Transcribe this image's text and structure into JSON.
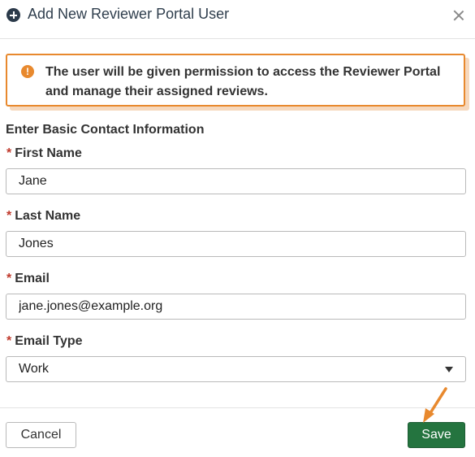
{
  "dialog": {
    "title": "Add New Reviewer Portal User",
    "header_icon": "plus-circle-icon",
    "close_icon": "close-icon"
  },
  "alert": {
    "icon": "exclamation-circle-icon",
    "icon_glyph": "!",
    "message": "The user will be given permission to access the Reviewer Portal and manage their assigned reviews.",
    "color": "#e8892e"
  },
  "form": {
    "section_title": "Enter Basic Contact Information",
    "required_marker": "*",
    "first_name": {
      "label": "First Name",
      "value": "Jane"
    },
    "last_name": {
      "label": "Last Name",
      "value": "Jones"
    },
    "email": {
      "label": "Email",
      "value": "jane.jones@example.org"
    },
    "email_type": {
      "label": "Email Type",
      "value": "Work"
    }
  },
  "footer": {
    "cancel_label": "Cancel",
    "save_label": "Save",
    "save_color": "#24743f"
  },
  "annotation": {
    "type": "arrow",
    "target": "save-button",
    "color": "#e8892e"
  }
}
